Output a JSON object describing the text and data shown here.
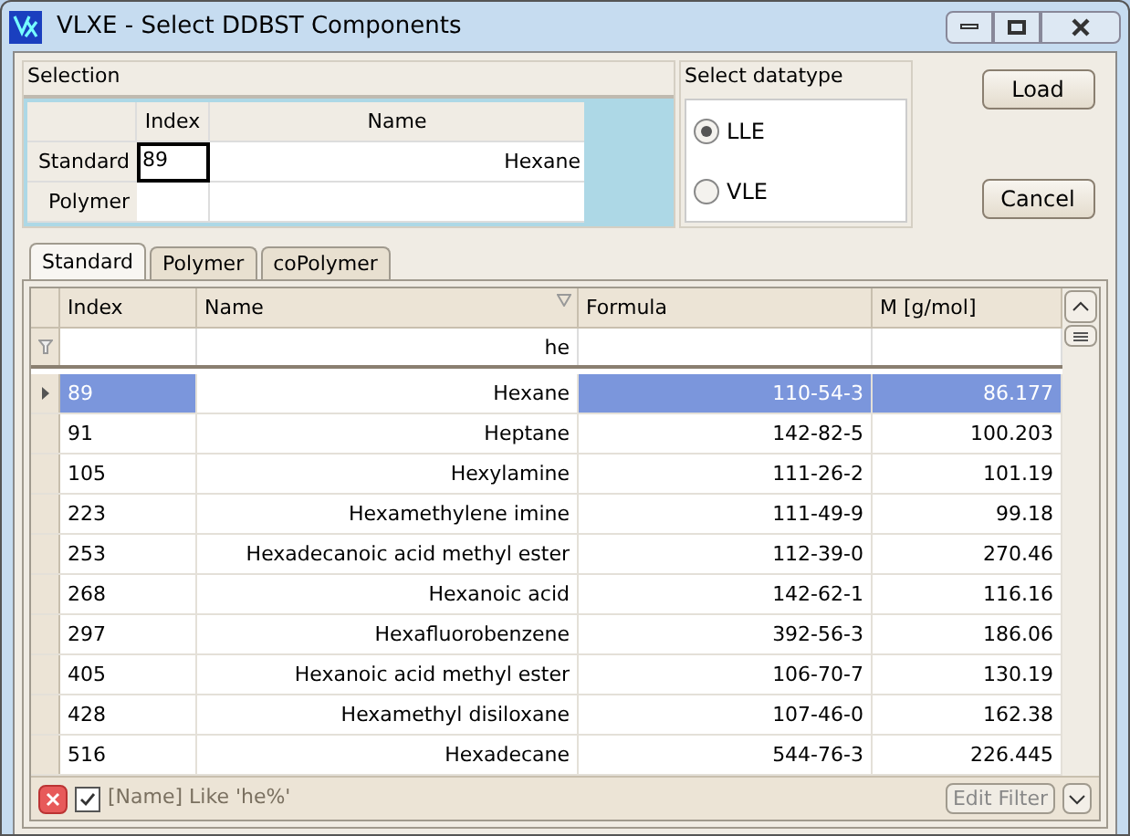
{
  "window": {
    "title": "VLXE - Select DDBST Components"
  },
  "selection": {
    "title": "Selection",
    "columns": [
      "Index",
      "Name"
    ],
    "rows": [
      {
        "label": "Standard",
        "index": "89",
        "name": "Hexane",
        "focused": true
      },
      {
        "label": "Polymer",
        "focused": false
      }
    ]
  },
  "datatype": {
    "title": "Select datatype",
    "options": [
      {
        "label": "LLE",
        "selected": true
      },
      {
        "label": "VLE",
        "selected": false
      }
    ]
  },
  "buttons": [
    "Load",
    "Cancel"
  ],
  "tabs": [
    {
      "label": "Standard",
      "selected": true
    },
    {
      "label": "Polymer",
      "selected": false
    },
    {
      "label": "coPolymer",
      "selected": false
    }
  ],
  "table": {
    "columns": [
      {
        "label": "Index",
        "focused": false
      },
      {
        "label": "Name",
        "filter": "he",
        "focused": true
      },
      {
        "label": "Formula",
        "focused": false
      },
      {
        "label": "M [g/mol]",
        "focused": false
      }
    ],
    "rows": [
      {
        "cells": [
          "89",
          "Hexane",
          "110-54-3",
          "86.177"
        ],
        "selected": true
      },
      {
        "cells": [
          "91",
          "Heptane",
          "142-82-5",
          "100.203"
        ],
        "selected": false
      },
      {
        "cells": [
          "105",
          "Hexylamine",
          "111-26-2",
          "101.19"
        ],
        "selected": false
      },
      {
        "cells": [
          "223",
          "Hexamethylene imine",
          "111-49-9",
          "99.18"
        ],
        "selected": false
      },
      {
        "cells": [
          "253",
          "Hexadecanoic acid methyl ester",
          "112-39-0",
          "270.46"
        ],
        "selected": false
      },
      {
        "cells": [
          "268",
          "Hexanoic acid",
          "142-62-1",
          "116.16"
        ],
        "selected": false
      },
      {
        "cells": [
          "297",
          "Hexafluorobenzene",
          "392-56-3",
          "186.06"
        ],
        "selected": false
      },
      {
        "cells": [
          "405",
          "Hexanoic acid methyl ester",
          "106-70-7",
          "130.19"
        ],
        "selected": false
      },
      {
        "cells": [
          "428",
          "Hexamethyl disiloxane",
          "107-46-0",
          "162.38"
        ],
        "selected": false
      },
      {
        "cells": [
          "516",
          "Hexadecane",
          "544-76-3",
          "226.445"
        ],
        "selected": false
      }
    ]
  },
  "filter_bar": {
    "enabled": true,
    "expression": "[Name] Like 'he%'",
    "button": "Edit Filter"
  }
}
